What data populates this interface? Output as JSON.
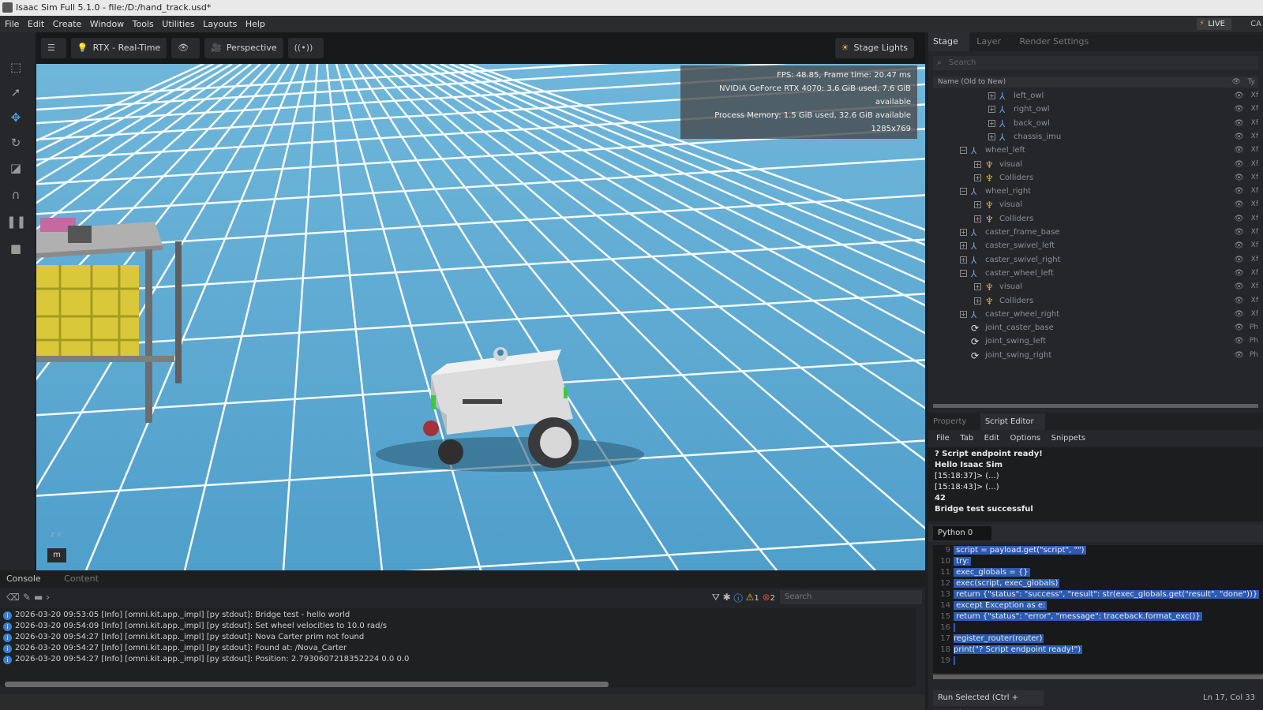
{
  "window": {
    "title": "Isaac Sim Full 5.1.0 - file:/D:/hand_track.usd*"
  },
  "menu": [
    "File",
    "Edit",
    "Create",
    "Window",
    "Tools",
    "Utilities",
    "Layouts",
    "Help"
  ],
  "live": {
    "label": "LIVE",
    "extra": "CA"
  },
  "viewport": {
    "toolbar": {
      "renderer": "RTX - Real-Time",
      "camera": "Perspective",
      "stage_lights": "Stage Lights"
    },
    "hud": {
      "fps": "FPS: 48.85, Frame time: 20.47 ms",
      "gpu": "NVIDIA GeForce RTX 4070: 3.6 GiB used, 7.6 GiB available",
      "memory": "Process Memory: 1.5 GiB used, 32.6 GiB available",
      "resolution": "1285x769"
    },
    "units_button": "m",
    "axis_z": "z",
    "axis_x": "x"
  },
  "console": {
    "tabs": [
      "Console",
      "Content"
    ],
    "search_placeholder": "Search",
    "warn_count": "1",
    "error_count": "2",
    "lines": [
      "2026-03-20 09:53:05  [Info] [omni.kit.app._impl] [py stdout]: Bridge test - hello world",
      "2026-03-20 09:54:09  [Info] [omni.kit.app._impl] [py stdout]: Set wheel velocities to 10.0 rad/s",
      "2026-03-20 09:54:27  [Info] [omni.kit.app._impl] [py stdout]: Nova Carter prim not found",
      "2026-03-20 09:54:27  [Info] [omni.kit.app._impl] [py stdout]: Found at: /Nova_Carter",
      "2026-03-20 09:54:27  [Info] [omni.kit.app._impl] [py stdout]: Position: 2.7930607218352224 0.0 0.0"
    ]
  },
  "stage": {
    "tabs": [
      "Stage",
      "Layer",
      "Render Settings"
    ],
    "search_placeholder": "Search",
    "header": "Name (Old to New)",
    "header_type": "Ty",
    "rows": [
      {
        "label": "left_owl",
        "level": 3,
        "exp": "+",
        "icon": "xform",
        "type": "Xf"
      },
      {
        "label": "right_owl",
        "level": 3,
        "exp": "+",
        "icon": "xform",
        "type": "Xf"
      },
      {
        "label": "back_owl",
        "level": 3,
        "exp": "+",
        "icon": "xform",
        "type": "Xf"
      },
      {
        "label": "chassis_imu",
        "level": 3,
        "exp": "+",
        "icon": "xform",
        "type": "Xf"
      },
      {
        "label": "wheel_left",
        "level": 1,
        "exp": "−",
        "icon": "xform",
        "type": "Xf"
      },
      {
        "label": "visual",
        "level": 2,
        "exp": "+",
        "icon": "mesh",
        "type": "Xf"
      },
      {
        "label": "Colliders",
        "level": 2,
        "exp": "+",
        "icon": "mesh",
        "type": "Xf"
      },
      {
        "label": "wheel_right",
        "level": 1,
        "exp": "−",
        "icon": "xform",
        "type": "Xf"
      },
      {
        "label": "visual",
        "level": 2,
        "exp": "+",
        "icon": "mesh",
        "type": "Xf"
      },
      {
        "label": "Colliders",
        "level": 2,
        "exp": "+",
        "icon": "mesh",
        "type": "Xf"
      },
      {
        "label": "caster_frame_base",
        "level": 1,
        "exp": "+",
        "icon": "xform",
        "type": "Xf"
      },
      {
        "label": "caster_swivel_left",
        "level": 1,
        "exp": "+",
        "icon": "xform",
        "type": "Xf"
      },
      {
        "label": "caster_swivel_right",
        "level": 1,
        "exp": "+",
        "icon": "xform",
        "type": "Xf"
      },
      {
        "label": "caster_wheel_left",
        "level": 1,
        "exp": "−",
        "icon": "xform",
        "type": "Xf"
      },
      {
        "label": "visual",
        "level": 2,
        "exp": "+",
        "icon": "mesh",
        "type": "Xf"
      },
      {
        "label": "Colliders",
        "level": 2,
        "exp": "+",
        "icon": "mesh",
        "type": "Xf"
      },
      {
        "label": "caster_wheel_right",
        "level": 1,
        "exp": "+",
        "icon": "xform",
        "type": "Xf"
      },
      {
        "label": "joint_caster_base",
        "level": 1,
        "exp": "",
        "icon": "joint",
        "type": "Ph"
      },
      {
        "label": "joint_swing_left",
        "level": 1,
        "exp": "",
        "icon": "joint",
        "type": "Ph"
      },
      {
        "label": "joint_swing_right",
        "level": 1,
        "exp": "",
        "icon": "joint",
        "type": "Ph"
      }
    ]
  },
  "property_tabs": [
    "Property",
    "Script Editor"
  ],
  "script_editor": {
    "menu": [
      "File",
      "Tab",
      "Edit",
      "Options",
      "Snippets"
    ],
    "output": [
      "? Script endpoint ready!",
      "Hello Isaac Sim",
      "[15:18:37]> (...)",
      "[15:18:43]> (...)",
      "42",
      "Bridge test successful"
    ],
    "python_tab": "Python 0",
    "code": [
      {
        "n": "9",
        "t": "    script = payload.get(\"script\", \"\")"
      },
      {
        "n": "10",
        "t": "    try:"
      },
      {
        "n": "11",
        "t": "        exec_globals = {}"
      },
      {
        "n": "12",
        "t": "        exec(script, exec_globals)"
      },
      {
        "n": "13",
        "t": "        return {\"status\": \"success\", \"result\": str(exec_globals.get(\"result\", \"done\"))}"
      },
      {
        "n": "14",
        "t": "    except Exception as e:"
      },
      {
        "n": "15",
        "t": "        return {\"status\": \"error\", \"message\": traceback.format_exc()}"
      },
      {
        "n": "16",
        "t": ""
      },
      {
        "n": "17",
        "t": "register_router(router)"
      },
      {
        "n": "18",
        "t": "print(\"? Script endpoint ready!\")"
      },
      {
        "n": "19",
        "t": ""
      }
    ],
    "run_button": "Run Selected (Ctrl + Enter)",
    "cursor": "Ln 17, Col 33"
  },
  "colors": {
    "accent": "#4fa3d8",
    "floor": "#5aa8d2",
    "grid": "#ffffff",
    "selection": "#2d5bb0"
  },
  "icons": {
    "left_tools": [
      "select-icon",
      "pointer-icon",
      "move-icon",
      "rotate-icon",
      "scale-icon",
      "snap-icon",
      "pause-icon",
      "stop-icon"
    ]
  }
}
